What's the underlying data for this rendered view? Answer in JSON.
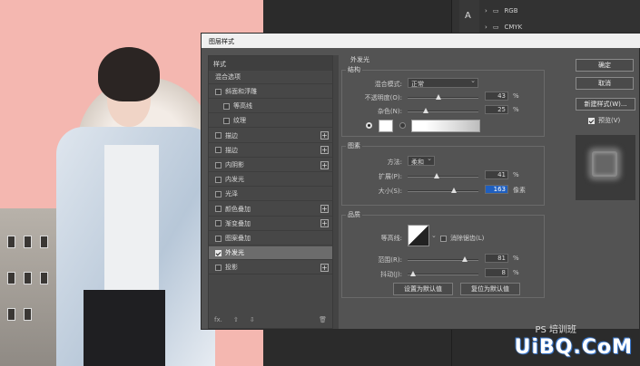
{
  "channels": [
    "RGB",
    "CMYK"
  ],
  "tool_letter": "A",
  "dialog": {
    "title": "图层样式",
    "styles_header": "样式",
    "blend_options": "混合选项",
    "effects": [
      {
        "label": "斜面和浮雕",
        "checked": false,
        "plus": false
      },
      {
        "label": "等高线",
        "checked": false,
        "plus": false,
        "indent": true
      },
      {
        "label": "纹理",
        "checked": false,
        "plus": false,
        "indent": true
      },
      {
        "label": "描边",
        "checked": false,
        "plus": true
      },
      {
        "label": "描边",
        "checked": false,
        "plus": true
      },
      {
        "label": "内阴影",
        "checked": false,
        "plus": true
      },
      {
        "label": "内发光",
        "checked": false,
        "plus": false
      },
      {
        "label": "光泽",
        "checked": false,
        "plus": false
      },
      {
        "label": "颜色叠加",
        "checked": false,
        "plus": true
      },
      {
        "label": "渐变叠加",
        "checked": false,
        "plus": true
      },
      {
        "label": "图案叠加",
        "checked": false,
        "plus": false
      },
      {
        "label": "外发光",
        "checked": true,
        "plus": false,
        "selected": true
      },
      {
        "label": "投影",
        "checked": false,
        "plus": true
      }
    ],
    "footer_fx": "fx.",
    "outer_glow": {
      "title": "外发光",
      "structure": {
        "title": "结构",
        "blend_mode_label": "混合模式:",
        "blend_mode": "正常",
        "opacity_label": "不透明度(O):",
        "opacity": "43",
        "noise_label": "杂色(N):",
        "noise": "25",
        "unit": "%"
      },
      "elements": {
        "title": "图素",
        "technique_label": "方法:",
        "technique": "柔和",
        "spread_label": "扩展(P):",
        "spread": "41",
        "size_label": "大小(S):",
        "size": "163",
        "size_unit": "像素"
      },
      "quality": {
        "title": "品质",
        "contour_label": "等高线:",
        "antialias_label": "消除锯齿(L)",
        "range_label": "范围(R):",
        "range": "81",
        "jitter_label": "抖动(J):",
        "jitter": "8"
      },
      "set_default": "设置为默认值",
      "reset_default": "复位为默认值"
    },
    "buttons": {
      "ok": "确定",
      "cancel": "取消",
      "new_style": "新建样式(W)...",
      "preview": "预览(V)"
    }
  },
  "watermark": {
    "sub": "PS 培训班",
    "main": "UiBQ.CoM"
  },
  "sliders": {
    "opacity": 0.43,
    "noise": 0.25,
    "spread": 0.41,
    "size": 0.65,
    "range": 0.81,
    "jitter": 0.08
  }
}
